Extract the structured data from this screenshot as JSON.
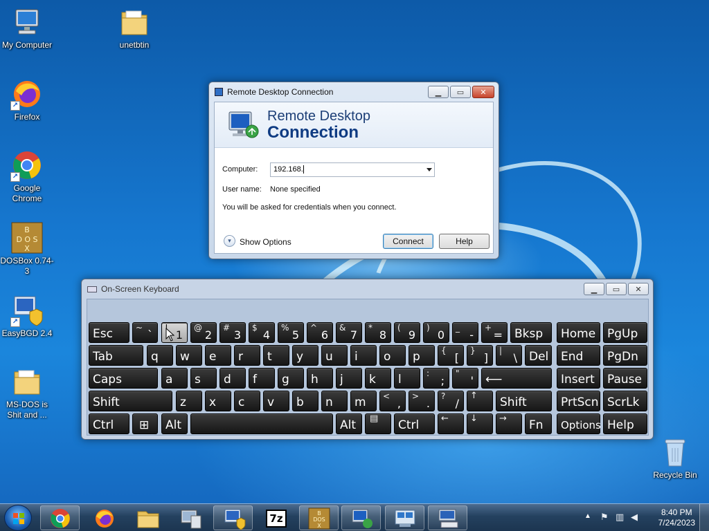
{
  "desktop_icons": [
    {
      "id": "my-computer",
      "label": "My Computer"
    },
    {
      "id": "unetbtin",
      "label": "unetbtin"
    },
    {
      "id": "firefox",
      "label": "Firefox"
    },
    {
      "id": "google-chrome",
      "label": "Google Chrome"
    },
    {
      "id": "dosbox",
      "label": "DOSBox 0.74-3"
    },
    {
      "id": "easybcd",
      "label": "EasyBGD 2.4"
    },
    {
      "id": "msdos",
      "label": "MS-DOS is Shit and ..."
    },
    {
      "id": "recycle-bin",
      "label": "Recycle Bin"
    }
  ],
  "rdc": {
    "title": "Remote Desktop Connection",
    "banner_line1": "Remote Desktop",
    "banner_line2": "Connection",
    "computer_label": "Computer:",
    "computer_value": "192.168.",
    "username_label": "User name:",
    "username_value": "None specified",
    "info_text": "You will be asked for credentials when you connect.",
    "show_options": "Show Options",
    "connect_button": "Connect",
    "help_button": "Help"
  },
  "osk": {
    "title": "On-Screen Keyboard",
    "pressed_key": "1",
    "keys": {
      "esc": "Esc",
      "tilde_shift": "~",
      "tilde_main": "`",
      "k1_shift": "!",
      "k1": "1",
      "k2_shift": "@",
      "k2": "2",
      "k3_shift": "#",
      "k3": "3",
      "k4_shift": "$",
      "k4": "4",
      "k5_shift": "%",
      "k5": "5",
      "k6_shift": "^",
      "k6": "6",
      "k7_shift": "&",
      "k7": "7",
      "k8_shift": "*",
      "k8": "8",
      "k9_shift": "(",
      "k9": "9",
      "k0_shift": ")",
      "k0": "0",
      "minus_shift": "_",
      "minus": "-",
      "equals_shift": "+",
      "equals": "=",
      "bksp": "Bksp",
      "home": "Home",
      "pgup": "PgUp",
      "tab": "Tab",
      "q": "q",
      "w": "w",
      "e": "e",
      "r": "r",
      "t": "t",
      "y": "y",
      "u": "u",
      "i": "i",
      "o": "o",
      "p": "p",
      "lbracket_shift": "{",
      "lbracket": "[",
      "rbracket_shift": "}",
      "rbracket": "]",
      "backslash_shift": "|",
      "backslash": "\\",
      "del": "Del",
      "end": "End",
      "pgdn": "PgDn",
      "caps": "Caps",
      "a": "a",
      "s": "s",
      "d": "d",
      "f": "f",
      "g": "g",
      "h": "h",
      "j": "j",
      "k": "k",
      "l": "l",
      "semicolon_shift": ":",
      "semicolon": ";",
      "quote_shift": "\"",
      "quote": "'",
      "enter": "⟵",
      "insert": "Insert",
      "pause": "Pause",
      "shift_l": "Shift",
      "z": "z",
      "x": "x",
      "c": "c",
      "v": "v",
      "b": "b",
      "n": "n",
      "m": "m",
      "comma_shift": "<",
      "comma": ",",
      "period_shift": ">",
      "period": ".",
      "slash_shift": "?",
      "slash": "/",
      "up": "↑",
      "shift_r": "Shift",
      "prtscn": "PrtScn",
      "scrlk": "ScrLk",
      "ctrl_l": "Ctrl",
      "win": "⊞",
      "alt_l": "Alt",
      "alt_r": "Alt",
      "menu": "▤",
      "ctrl_r": "Ctrl",
      "left": "←",
      "down": "↓",
      "right": "→",
      "fn": "Fn",
      "options": "Options",
      "help": "Help"
    }
  },
  "taskbar": {
    "time": "8:40 PM",
    "date": "7/24/2023",
    "pinned": [
      "Google Chrome",
      "Firefox",
      "Windows Explorer",
      "Computer",
      "EasyBCD",
      "7-Zip",
      "DOSBox",
      "Remote Desktop Connection",
      "Network",
      "On-Screen Keyboard"
    ],
    "sevenzip_label": "7z"
  }
}
